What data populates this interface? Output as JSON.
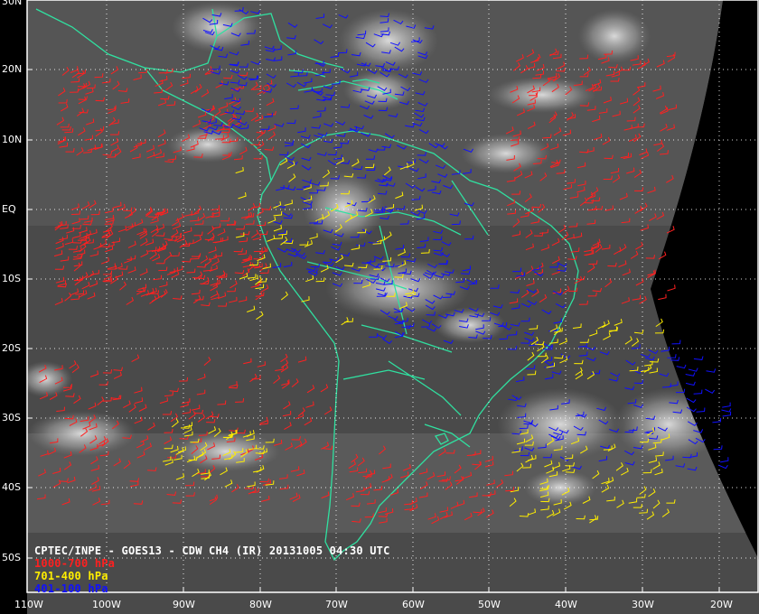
{
  "header": {
    "title": "CPTEC/INPE - GOES13 - CDW CH4 (IR) 20131005 04:30 UTC"
  },
  "legend": [
    {
      "label": "1000-700 hPa",
      "color": "#ff2020"
    },
    {
      "label": "701-400 hPa",
      "color": "#ffee00"
    },
    {
      "label": "401-100 hPa",
      "color": "#1010ff"
    }
  ],
  "lat_labels": [
    "30N",
    "20N",
    "10N",
    "EQ",
    "10S",
    "20S",
    "30S",
    "40S",
    "50S"
  ],
  "lon_labels": [
    "110W",
    "100W",
    "90W",
    "80W",
    "70W",
    "60W",
    "50W",
    "40W",
    "30W",
    "20W"
  ],
  "colors": {
    "background": "#000000",
    "coastline": "#30e0a0",
    "gridline": "#ffffff",
    "caption": "#ffffff"
  }
}
